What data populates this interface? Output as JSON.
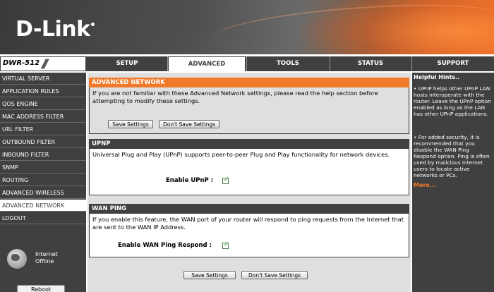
{
  "brand": {
    "logo_text": "D-Link",
    "accent": "#f07a2a",
    "dark": "#404040"
  },
  "model": "DWR-512",
  "nav": {
    "tabs": [
      {
        "label": "SETUP"
      },
      {
        "label": "ADVANCED"
      },
      {
        "label": "TOOLS"
      },
      {
        "label": "STATUS"
      },
      {
        "label": "SUPPORT"
      }
    ]
  },
  "sidebar": {
    "items": [
      {
        "label": "VIRTUAL SERVER"
      },
      {
        "label": "APPLICATION RULES"
      },
      {
        "label": "QOS ENGINE"
      },
      {
        "label": "MAC ADDRESS FILTER"
      },
      {
        "label": "URL FILTER"
      },
      {
        "label": "OUTBOUND FILTER"
      },
      {
        "label": "INBOUND FILTER"
      },
      {
        "label": "SNMP"
      },
      {
        "label": "ROUTING"
      },
      {
        "label": "ADVANCED WIRELESS"
      },
      {
        "label": "ADVANCED NETWORK"
      },
      {
        "label": "LOGOUT"
      }
    ],
    "internet_status_line1": "Internet",
    "internet_status_line2": "Offline",
    "reboot_label": "Reboot"
  },
  "advanced_network": {
    "title": "ADVANCED NETWORK",
    "description": "If you are not familiar with these Advanced Network settings, please read the help section before attempting to modify these settings.",
    "save_label": "Save Settings",
    "dont_save_label": "Don't Save Settings"
  },
  "upnp": {
    "title": "UPNP",
    "description": "Universal Plug and Play (UPnP) supports peer-to-peer Plug and Play functionality for network devices.",
    "enable_label": "Enable UPnP :",
    "enabled": true
  },
  "wan_ping": {
    "title": "WAN PING",
    "description": "If you enable this feature, the WAN port of your router will respond to ping requests from the Internet that are sent to the WAN IP Address.",
    "enable_label": "Enable WAN Ping Respond :",
    "enabled": true
  },
  "bottom": {
    "save_label": "Save Settings",
    "dont_save_label": "Don't Save Settings"
  },
  "hints": {
    "title": "Helpful Hints..",
    "hint1": "• UPnP helps other UPnP LAN hosts interoperate with the router. Leave the UPnP option enabled as long as the LAN has other UPnP applications.",
    "hint2": "• For added security, it is recommended that you disable the WAN Ping Respond option. Ping is often used by malicious Internet users to locate active networks or PCs.",
    "more": "More..."
  }
}
